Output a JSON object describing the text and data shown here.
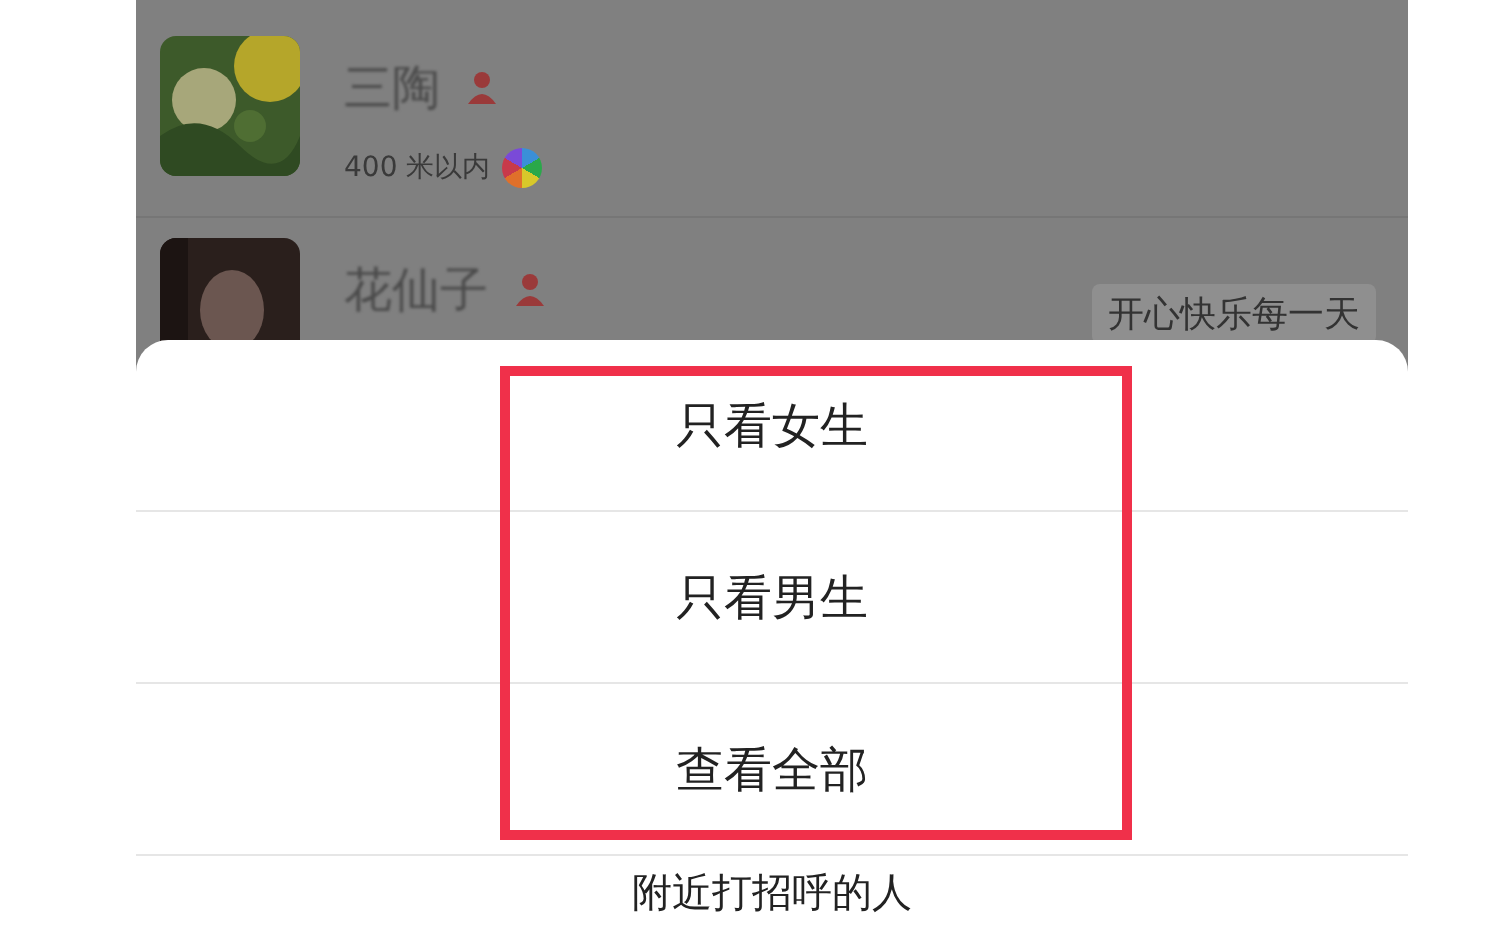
{
  "contacts": [
    {
      "name": "三陶",
      "gender_icon": true,
      "distance": "400 米以内"
    },
    {
      "name": "花仙子",
      "gender_icon": true,
      "signature": "开心快乐每一天"
    }
  ],
  "sheet": {
    "options": [
      {
        "label": "只看女生"
      },
      {
        "label": "只看男生"
      },
      {
        "label": "查看全部"
      },
      {
        "label": "附近打招呼的人"
      }
    ]
  },
  "annotation": {
    "kind": "frame",
    "color": "#f0304a"
  }
}
